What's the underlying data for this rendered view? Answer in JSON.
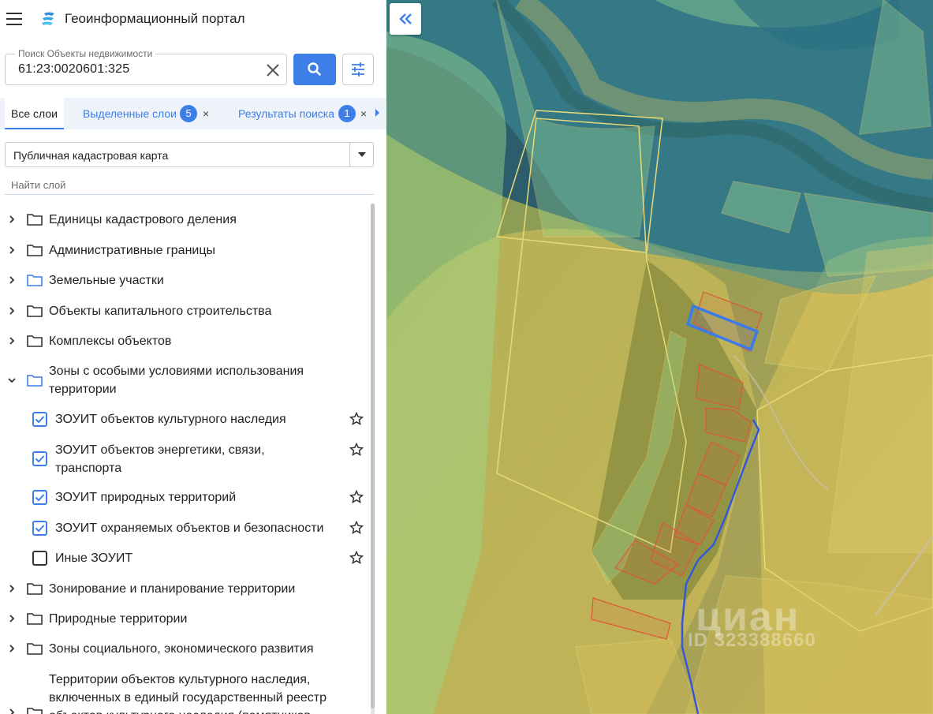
{
  "header": {
    "title": "Геоинформационный портал"
  },
  "search": {
    "legend": "Поиск Объекты недвижимости",
    "value": "61:23:0020601:325"
  },
  "tabs": {
    "all_label": "Все слои",
    "selected_label": "Выделенные слои",
    "selected_count": "5",
    "results_label": "Результаты поиска",
    "results_count": "1",
    "close_glyph": "×"
  },
  "basemap": {
    "value": "Публичная кадастровая карта"
  },
  "find_layer": {
    "placeholder": "Найти слой"
  },
  "tree": {
    "nodes": [
      {
        "label": "Единицы кадастрового деления"
      },
      {
        "label": "Административные границы"
      },
      {
        "label": "Земельные участки"
      },
      {
        "label": "Объекты капитального строительства"
      },
      {
        "label": "Комплексы объектов"
      },
      {
        "label": "Зоны с особыми условиями использования территории"
      },
      {
        "label": "Зонирование и планирование территории"
      },
      {
        "label": "Природные территории"
      },
      {
        "label": "Зоны социального, экономического развития"
      },
      {
        "label": "Территории объектов культурного наследия, включенных в единый государственный реестр объектов культурного наследия (памятников"
      }
    ],
    "sublayers": [
      {
        "label": "ЗОУИТ объектов культурного наследия",
        "checked": true
      },
      {
        "label": "ЗОУИТ объектов энергетики, связи, транспорта",
        "checked": true
      },
      {
        "label": "ЗОУИТ природных территорий",
        "checked": true
      },
      {
        "label": "ЗОУИТ охраняемых объектов и безопасности",
        "checked": true
      },
      {
        "label": "Иные ЗОУИТ",
        "checked": false
      }
    ]
  },
  "map": {
    "watermark": "циан",
    "watermark_id": "ID 323388660"
  },
  "icons": {
    "menu": "menu-icon",
    "logo": "portal-logo-icon",
    "clear": "close-icon",
    "search": "search-icon",
    "filter": "sliders-icon",
    "folder": "folder-icon",
    "star": "star-outline-icon",
    "collapse": "double-chevron-left-icon"
  },
  "colors": {
    "accent": "#3d7ee8",
    "tab_bg": "#eef3f9",
    "zone_yellow": "#d9c35a",
    "zone_teal": "#3d8f9a",
    "zone_green": "#9ed98f",
    "parcel_red": "#e0553a",
    "selected_parcel": "#3a7bea"
  }
}
